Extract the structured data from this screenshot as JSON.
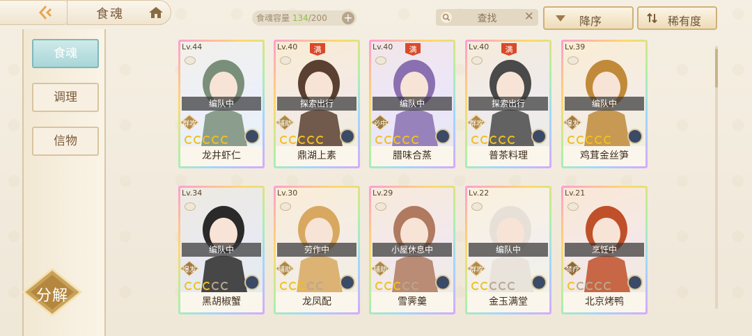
{
  "header": {
    "page_title": "食魂",
    "capacity_label": "食魂容量",
    "capacity_current": "134",
    "capacity_max": "/200",
    "search_label": "查找",
    "sort_label": "降序",
    "rarity_label": "稀有度"
  },
  "sidebar": {
    "items": [
      {
        "label": "食魂",
        "active": true
      },
      {
        "label": "调理",
        "active": false
      },
      {
        "label": "信物",
        "active": false
      }
    ],
    "decompose_label": "分解"
  },
  "cards": [
    {
      "level": "Lv.44",
      "max": "",
      "status": "编队中",
      "role": "群攻",
      "name": "龙井虾仁",
      "stars": 5
    },
    {
      "level": "Lv.40",
      "max": "满",
      "status": "探索出行",
      "role": "辅助",
      "name": "鼎湖上素",
      "stars": 5
    },
    {
      "level": "Lv.40",
      "max": "满",
      "status": "编队中",
      "role": "必中",
      "name": "腊味合蒸",
      "stars": 5
    },
    {
      "level": "Lv.40",
      "max": "满",
      "status": "探索出行",
      "role": "群攻",
      "name": "普茶料理",
      "stars": 5
    },
    {
      "level": "Lv.39",
      "max": "",
      "status": "编队中",
      "role": "爆发",
      "name": "鸡茸金丝笋",
      "stars": 5
    },
    {
      "level": "Lv.34",
      "max": "",
      "status": "编队中",
      "role": "爆发",
      "name": "黑胡椒蟹",
      "stars": 3
    },
    {
      "level": "Lv.30",
      "max": "",
      "status": "劳作中",
      "role": "辅助",
      "name": "龙凤配",
      "stars": 3
    },
    {
      "level": "Lv.29",
      "max": "",
      "status": "小屋休息中",
      "role": "辅助",
      "name": "雪霁羹",
      "stars": 3
    },
    {
      "level": "Lv.22",
      "max": "",
      "status": "编队中",
      "role": "群攻",
      "name": "金玉满堂",
      "stars": 2
    },
    {
      "level": "Lv.21",
      "max": "",
      "status": "烹饪中",
      "role": "禁疗",
      "name": "北京烤鸭",
      "stars": 1
    }
  ]
}
